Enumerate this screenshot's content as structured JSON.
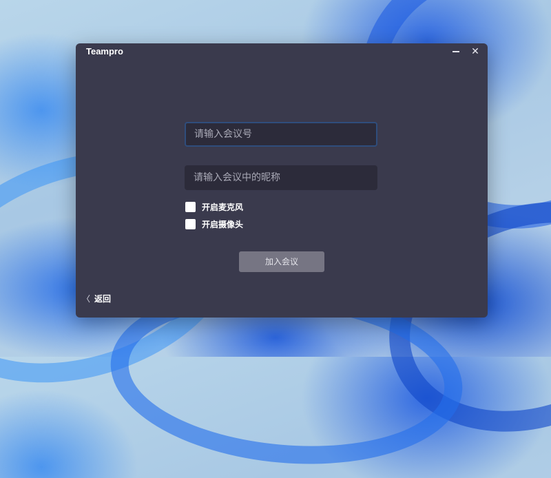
{
  "window": {
    "title": "Teampro",
    "minimize_icon": "minimize-icon",
    "close_icon": "close-icon",
    "close_glyph": "✕"
  },
  "form": {
    "meeting_id_placeholder": "请输入会议号",
    "meeting_id_value": "",
    "nickname_placeholder": "请输入会议中的昵称",
    "nickname_value": "",
    "mic_label": "开启麦克风",
    "mic_checked": false,
    "camera_label": "开启摄像头",
    "camera_checked": false,
    "join_button": "加入会议"
  },
  "footer": {
    "back_glyph": "〈",
    "back_label": "返回"
  },
  "colors": {
    "window_bg": "#3a3a4d",
    "input_bg": "#2c2b3a",
    "focus_border": "#2f4d7c",
    "join_button_bg": "#767583"
  }
}
